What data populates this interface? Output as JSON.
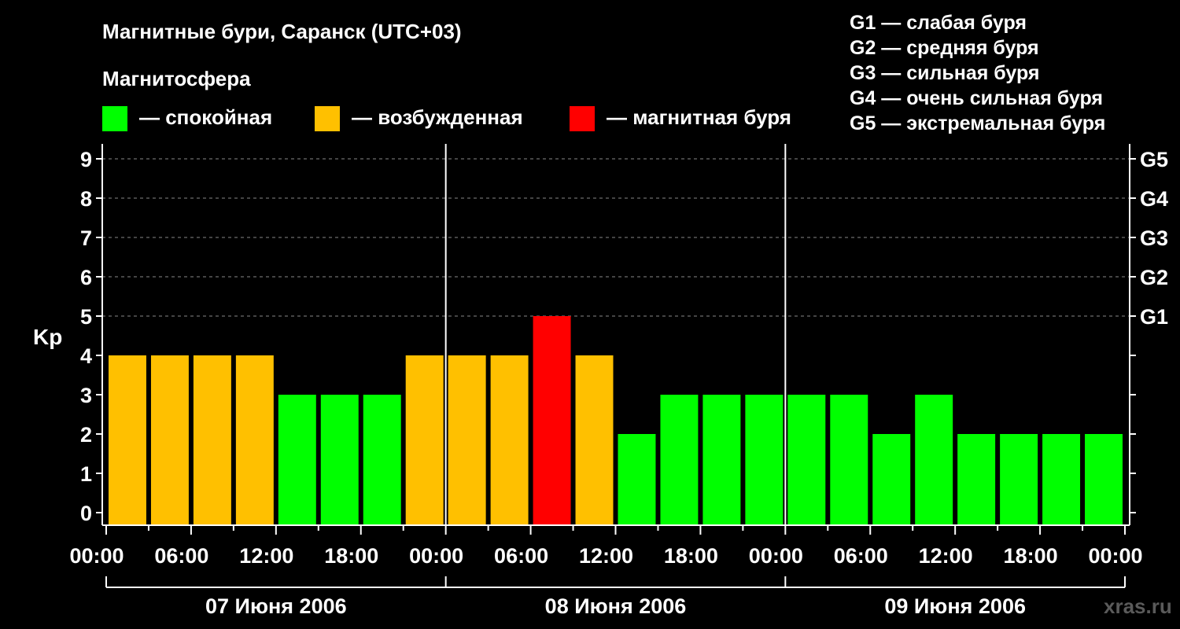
{
  "chart_data": {
    "type": "bar",
    "title": "Магнитные бури, Саранск (UTC+03)",
    "subtitle": "Магнитосфера",
    "ylabel": "Kp",
    "ylim": [
      0,
      9
    ],
    "yticks": [
      "0",
      "1",
      "2",
      "3",
      "4",
      "5",
      "6",
      "7",
      "8",
      "9"
    ],
    "right_ticks": [
      {
        "value": 5,
        "label": "G1"
      },
      {
        "value": 6,
        "label": "G2"
      },
      {
        "value": 7,
        "label": "G3"
      },
      {
        "value": 8,
        "label": "G4"
      },
      {
        "value": 9,
        "label": "G5"
      }
    ],
    "x_tick_labels": [
      "00:00",
      "06:00",
      "12:00",
      "18:00",
      "00:00",
      "06:00",
      "12:00",
      "18:00",
      "00:00",
      "06:00",
      "12:00",
      "18:00",
      "00:00"
    ],
    "days": [
      "07 Июня 2006",
      "08 Июня 2006",
      "09 Июня 2006"
    ],
    "interval_hours": 3,
    "values": [
      4,
      4,
      4,
      4,
      3,
      3,
      3,
      4,
      4,
      4,
      5,
      4,
      2,
      3,
      3,
      3,
      3,
      3,
      2,
      3,
      2,
      2,
      2,
      2
    ],
    "colors": {
      "calm": "#00FF00",
      "excited": "#FFC000",
      "storm": "#FF0000"
    },
    "legend_states": [
      {
        "label": "— спокойная",
        "color": "#00FF00"
      },
      {
        "label": "— возбужденная",
        "color": "#FFC000"
      },
      {
        "label": "— магнитная буря",
        "color": "#FF0000"
      }
    ],
    "storm_scale": [
      "G1 — слабая буря",
      "G2 — средняя буря",
      "G3 — сильная буря",
      "G4 — очень сильная буря",
      "G5 — экстремальная буря"
    ],
    "grid": true,
    "watermark": "xras.ru"
  }
}
